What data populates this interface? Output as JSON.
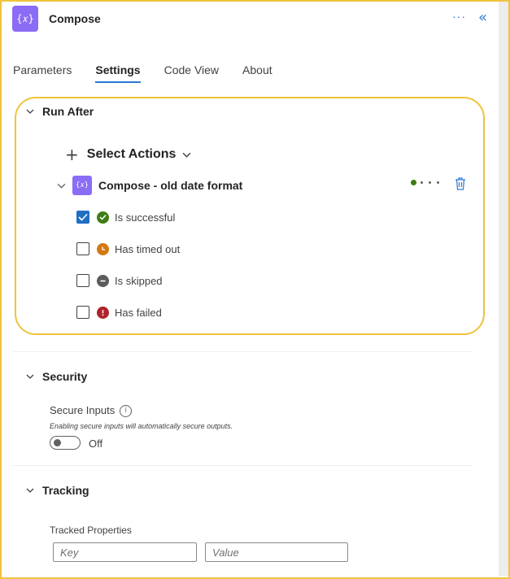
{
  "header": {
    "title": "Compose",
    "icon": "curly-braces-icon",
    "more_label": "···",
    "collapse_label": "«"
  },
  "tabs": [
    {
      "label": "Parameters",
      "active": false
    },
    {
      "label": "Settings",
      "active": true
    },
    {
      "label": "Code View",
      "active": false
    },
    {
      "label": "About",
      "active": false
    }
  ],
  "run_after": {
    "title": "Run After",
    "select_actions_label": "Select Actions",
    "action": {
      "title": "Compose - old date format",
      "statuses": [
        {
          "label": "Is successful",
          "checked": true,
          "icon": "success-check-icon",
          "color": "#3d7d14"
        },
        {
          "label": "Has timed out",
          "checked": false,
          "icon": "clock-icon",
          "color": "#d47811"
        },
        {
          "label": "Is skipped",
          "checked": false,
          "icon": "skipped-icon",
          "color": "#5c5c5c"
        },
        {
          "label": "Has failed",
          "checked": false,
          "icon": "failed-icon",
          "color": "#b0232c"
        }
      ]
    }
  },
  "security": {
    "title": "Security",
    "secure_inputs_label": "Secure Inputs",
    "hint": "Enabling secure inputs will automatically secure outputs.",
    "toggle_state": "Off"
  },
  "tracking": {
    "title": "Tracking",
    "tracked_properties_label": "Tracked Properties",
    "key_placeholder": "Key",
    "value_placeholder": "Value"
  },
  "colors": {
    "accent": "#2b79d6",
    "brand": "#8a6cf5",
    "highlight": "#f0c33c"
  }
}
